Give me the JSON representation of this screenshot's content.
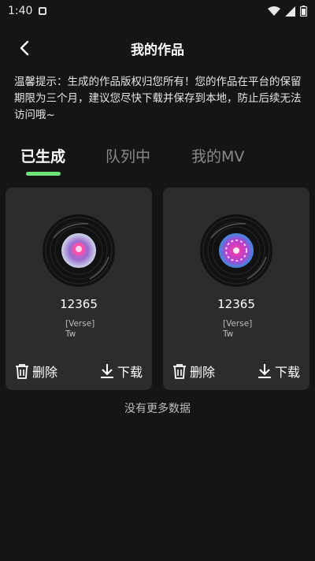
{
  "status_bar": {
    "time": "1:40"
  },
  "header": {
    "title": "我的作品"
  },
  "notice": "温馨提示：生成的作品版权归您所有！您的作品在平台的保留期限为三个月，建议您尽快下载并保存到本地，防止后续无法访问哦~",
  "tabs": [
    "已生成",
    "队列中",
    "我的MV"
  ],
  "active_tab": "已生成",
  "accent_color": "#6ee37a",
  "cards": [
    {
      "title": "12365",
      "lyric_line1": "[Verse]",
      "lyric_line2": "Tw",
      "delete_label": "删除",
      "download_label": "下载"
    },
    {
      "title": "12365",
      "lyric_line1": "[Verse]",
      "lyric_line2": "Tw",
      "delete_label": "删除",
      "download_label": "下载"
    }
  ],
  "footer": "没有更多数据"
}
